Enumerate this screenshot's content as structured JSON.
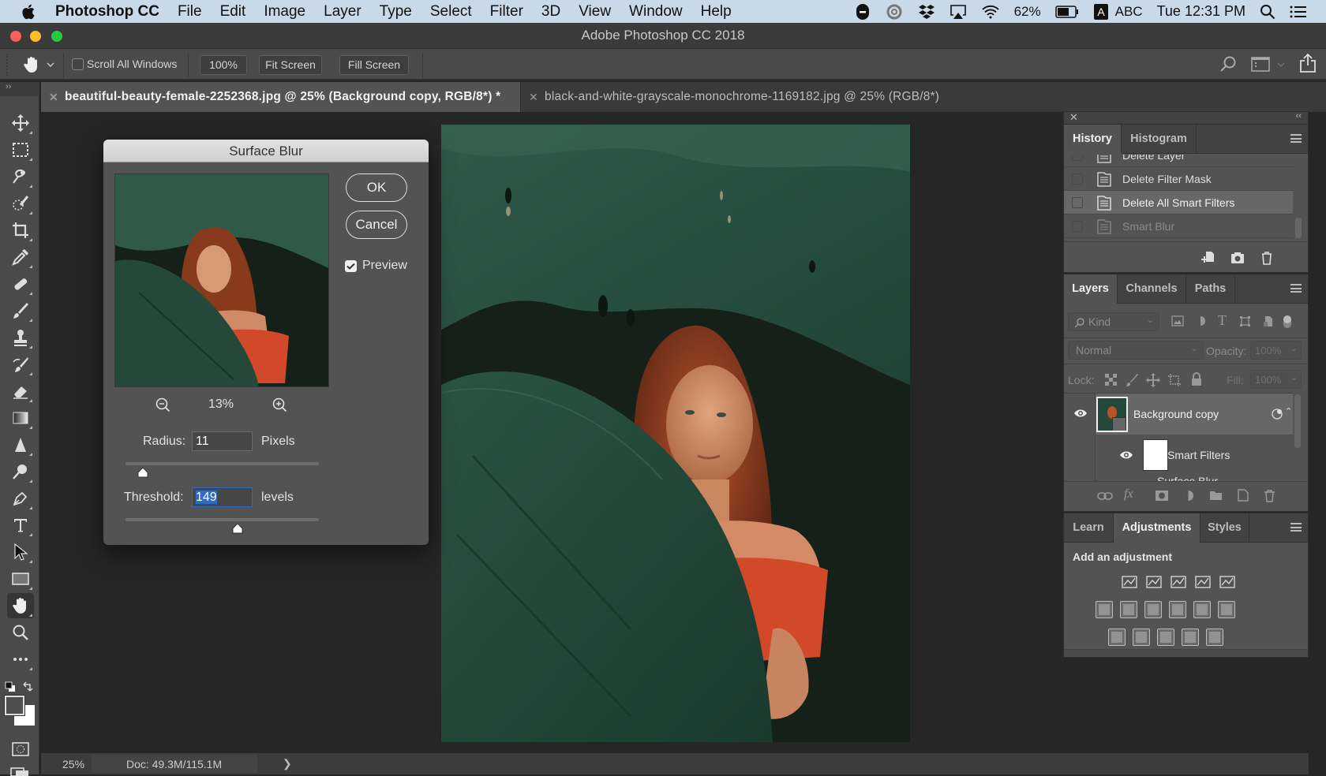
{
  "menubar": {
    "app_name": "Photoshop CC",
    "items": [
      "File",
      "Edit",
      "Image",
      "Layer",
      "Type",
      "Select",
      "Filter",
      "3D",
      "View",
      "Window",
      "Help"
    ],
    "battery": "62%",
    "input_source": "ABC",
    "clock": "Tue 12:31 PM",
    "status_icons": [
      "skype-icon",
      "creative-cloud-icon",
      "dropbox-icon",
      "airplay-icon",
      "wifi-icon",
      "battery-icon",
      "input-a-icon",
      "spotlight-icon",
      "notification-center-icon"
    ]
  },
  "window": {
    "title": "Adobe Photoshop CC 2018"
  },
  "options_bar": {
    "tool_icon": "hand-icon",
    "scroll_all_windows_label": "Scroll All Windows",
    "scroll_all_windows_checked": false,
    "zoom_100_label": "100%",
    "fit_screen_label": "Fit Screen",
    "fill_screen_label": "Fill Screen"
  },
  "document_tabs": [
    {
      "label": "beautiful-beauty-female-2252368.jpg @ 25% (Background copy, RGB/8*) *",
      "active": true
    },
    {
      "label": "black-and-white-grayscale-monochrome-1169182.jpg @ 25% (RGB/8*)",
      "active": false
    }
  ],
  "toolbar": {
    "tools": [
      "move",
      "rectangular-marquee",
      "lasso",
      "quick-selection",
      "crop",
      "eyedropper",
      "healing-brush",
      "brush",
      "clone-stamp",
      "history-brush",
      "eraser",
      "gradient",
      "sharpen",
      "dodge",
      "pen",
      "type",
      "path-selection",
      "rectangle",
      "hand",
      "zoom",
      "edit-toolbar"
    ],
    "active_tool": "hand"
  },
  "dialog": {
    "title": "Surface Blur",
    "ok_label": "OK",
    "cancel_label": "Cancel",
    "preview_label": "Preview",
    "preview_checked": true,
    "zoom_level": "13%",
    "radius_label": "Radius:",
    "radius_value": "11",
    "radius_unit": "Pixels",
    "radius_slider_fraction": 0.09,
    "threshold_label": "Threshold:",
    "threshold_value": "149",
    "threshold_unit": "levels",
    "threshold_slider_fraction": 0.58
  },
  "status_bar": {
    "zoom": "25%",
    "doc_info": "Doc: 49.3M/115.1M"
  },
  "history_panel": {
    "tabs": [
      "History",
      "Histogram"
    ],
    "active_tab": "History",
    "items": [
      {
        "label": "Delete Layer",
        "state": "normal"
      },
      {
        "label": "Delete Filter Mask",
        "state": "normal"
      },
      {
        "label": "Delete All Smart Filters",
        "state": "selected"
      },
      {
        "label": "Smart Blur",
        "state": "dimmed"
      }
    ]
  },
  "layers_panel": {
    "tabs": [
      "Layers",
      "Channels",
      "Paths"
    ],
    "active_tab": "Layers",
    "filter_kind": "Kind",
    "blend_mode": "Normal",
    "opacity_label": "Opacity:",
    "opacity_value": "100%",
    "lock_label": "Lock:",
    "fill_label": "Fill:",
    "fill_value": "100%",
    "layers": [
      {
        "name": "Background copy",
        "visible": true,
        "type": "smart-object"
      },
      {
        "name": "Smart Filters",
        "visible": true,
        "type": "filter-mask"
      },
      {
        "name": "Surface Blur",
        "visible": true,
        "type": "filter"
      }
    ]
  },
  "adjustments_panel": {
    "tabs": [
      "Learn",
      "Adjustments",
      "Styles"
    ],
    "active_tab": "Adjustments",
    "heading": "Add an adjustment",
    "rows": [
      [
        "brightness-contrast",
        "levels",
        "curves",
        "exposure",
        "vibrance"
      ],
      [
        "hue-saturation",
        "color-balance",
        "black-white",
        "photo-filter",
        "channel-mixer",
        "color-lookup"
      ],
      [
        "invert",
        "posterize",
        "threshold",
        "selective-color",
        "gradient-map"
      ]
    ]
  },
  "colors": {
    "ui_dark": "#262626",
    "panel_bg": "#535353",
    "selection_blue": "#2d6bc4",
    "menubar_bg": "#c9d9e8"
  }
}
